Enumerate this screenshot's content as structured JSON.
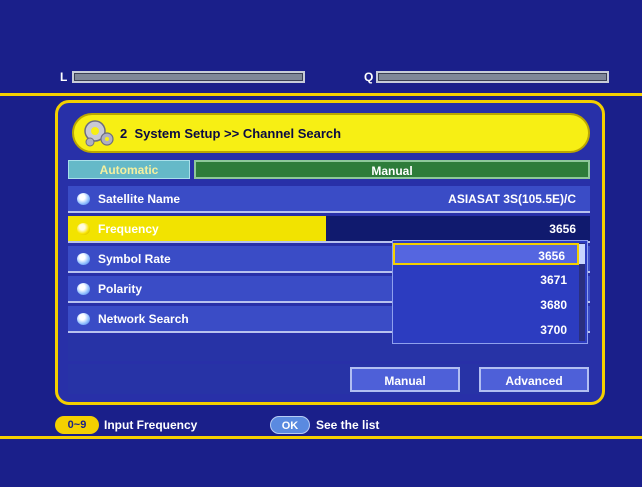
{
  "meters": {
    "level_label": "L",
    "quality_label": "Q"
  },
  "header": {
    "step_number": "2",
    "breadcrumb": "System Setup >> Channel Search"
  },
  "tabs": [
    {
      "label": "Automatic",
      "active": false
    },
    {
      "label": "Manual",
      "active": true
    }
  ],
  "rows": [
    {
      "label": "Satellite Name",
      "value": "ASIASAT 3S(105.5E)/C"
    },
    {
      "label": "Frequency",
      "value": "3656"
    },
    {
      "label": "Symbol Rate",
      "value": ""
    },
    {
      "label": "Polarity",
      "value": ""
    },
    {
      "label": "Network Search",
      "value": ""
    }
  ],
  "dropdown": {
    "options": [
      "3656",
      "3671",
      "3680",
      "3700"
    ],
    "selected": "3656"
  },
  "buttons": {
    "manual": "Manual",
    "advanced": "Advanced"
  },
  "footer": {
    "key1": "0~9",
    "hint1": "Input Frequency",
    "key2": "OK",
    "hint2": "See the list"
  },
  "colors": {
    "background": "#1a1f8a",
    "accent_yellow": "#f4d000",
    "highlight": "#f2e300"
  }
}
